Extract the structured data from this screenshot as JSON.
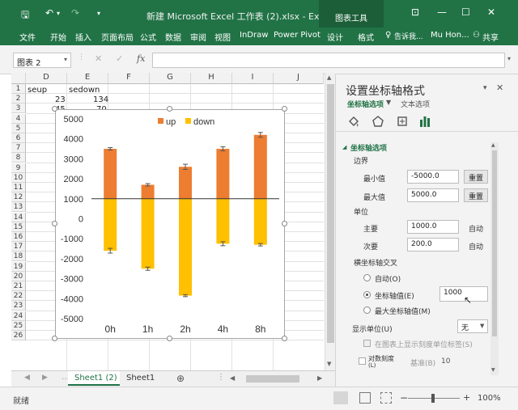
{
  "titlebar": {
    "title": "新建 Microsoft Excel 工作表 (2).xlsx - Excel",
    "context_tab": "图表工具",
    "save_icon": "save-icon",
    "undo_icon": "undo-icon",
    "redo_icon": "redo-icon"
  },
  "ribbon": {
    "tabs": [
      "文件",
      "开始",
      "插入",
      "页面布局",
      "公式",
      "数据",
      "审阅",
      "视图",
      "InDraw",
      "Power Pivot",
      "设计",
      "格式"
    ],
    "tell_me": "告诉我...",
    "user": "Mu Hon...",
    "share": "共享"
  },
  "formula_bar": {
    "name_box": "图表 2",
    "fx": "fx",
    "cancel": "✕",
    "enter": "✓",
    "value": ""
  },
  "sheet": {
    "columns": [
      "D",
      "E",
      "F",
      "G",
      "H",
      "I",
      "J"
    ],
    "rows": [
      "1",
      "2",
      "3",
      "4",
      "5",
      "6",
      "7",
      "8",
      "9",
      "10",
      "11",
      "12",
      "13",
      "14",
      "15",
      "16",
      "17",
      "18",
      "19",
      "20",
      "21",
      "22",
      "23",
      "24",
      "25",
      "26"
    ],
    "cells": {
      "D1": "seup",
      "E1": "sedown",
      "D2": "23",
      "E2": "134",
      "D3": "45",
      "E3": "70"
    }
  },
  "chart_data": {
    "type": "bar",
    "categories": [
      "0h",
      "1h",
      "2h",
      "4h",
      "8h"
    ],
    "series": [
      {
        "name": "up",
        "values": [
          3500,
          1700,
          2600,
          3500,
          4200
        ],
        "errors": [
          60,
          60,
          130,
          100,
          120
        ],
        "color": "#ED7D31"
      },
      {
        "name": "down",
        "values": [
          -1600,
          -2500,
          -3850,
          -1250,
          -1300
        ],
        "errors": [
          120,
          80,
          50,
          100,
          60
        ],
        "color": "#FFC000"
      }
    ],
    "ylim": [
      -5000,
      5000
    ],
    "yticks": [
      5000,
      4000,
      3000,
      2000,
      1000,
      0,
      -1000,
      -2000,
      -3000,
      -4000,
      -5000
    ],
    "ytick_labels": [
      "5000",
      "4000",
      "3000",
      "2000",
      "1000",
      "0",
      "-1000",
      "-2000",
      "-3000",
      "-4000",
      "-5000"
    ],
    "axis_crosses": 1000,
    "legend": "top",
    "grid": false
  },
  "pane": {
    "title": "设置坐标轴格式",
    "tab_axis": "坐标轴选项",
    "tab_text": "文本选项",
    "section": "坐标轴选项",
    "bounds_label": "边界",
    "min_label": "最小值",
    "min_value": "-5000.0",
    "max_label": "最大值",
    "max_value": "5000.0",
    "reset": "重置",
    "units_label": "单位",
    "major_label": "主要",
    "major_value": "1000.0",
    "minor_label": "次要",
    "minor_value": "200.0",
    "auto": "自动",
    "cross_label": "横坐标轴交叉",
    "opt_auto": "自动(O)",
    "opt_value": "坐标轴值(E)",
    "opt_value_input": "1000",
    "opt_max": "最大坐标轴值(M)",
    "display_units_label": "显示单位(U)",
    "display_units_value": "无",
    "show_units_label": "在图表上显示刻度单位标签(S)",
    "log_label": "对数刻度",
    "log_sub": "(L)",
    "base_label": "基准(B)",
    "base_value": "10"
  },
  "sheets": {
    "tabs": [
      "Sheet1 (2)",
      "Sheet1"
    ],
    "active": 0
  },
  "status": {
    "ready": "就绪",
    "zoom": "100%",
    "zoom_minus": "−",
    "zoom_plus": "+"
  }
}
